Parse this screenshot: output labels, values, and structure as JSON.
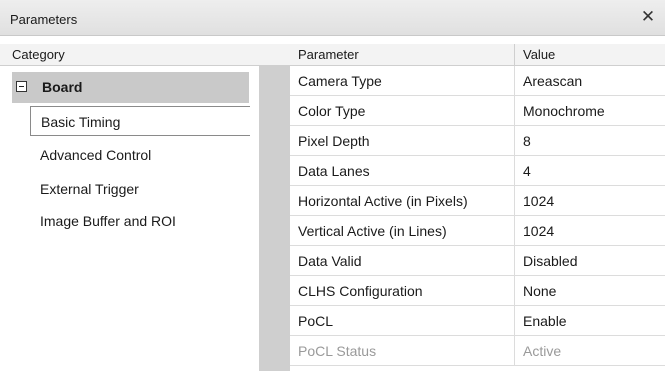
{
  "window": {
    "title": "Parameters",
    "close_label": "✕"
  },
  "headers": {
    "category": "Category",
    "parameter": "Parameter",
    "value": "Value"
  },
  "categories": {
    "group": {
      "label": "Board",
      "expanded": true
    },
    "items": [
      {
        "label": "Basic Timing",
        "selected": true
      },
      {
        "label": "Advanced Control",
        "selected": false
      },
      {
        "label": "External Trigger",
        "selected": false
      },
      {
        "label": "Image Buffer and ROI",
        "selected": false
      }
    ]
  },
  "parameters": [
    {
      "name": "Camera Type",
      "value": "Areascan",
      "enabled": true
    },
    {
      "name": "Color Type",
      "value": "Monochrome",
      "enabled": true
    },
    {
      "name": "Pixel Depth",
      "value": "8",
      "enabled": true
    },
    {
      "name": "Data Lanes",
      "value": "4",
      "enabled": true
    },
    {
      "name": "Horizontal Active (in Pixels)",
      "value": "1024",
      "enabled": true
    },
    {
      "name": "Vertical Active (in Lines)",
      "value": "1024",
      "enabled": true
    },
    {
      "name": "Data Valid",
      "value": "Disabled",
      "enabled": true
    },
    {
      "name": "CLHS Configuration",
      "value": "None",
      "enabled": true
    },
    {
      "name": "PoCL",
      "value": "Enable",
      "enabled": true
    },
    {
      "name": "PoCL Status",
      "value": "Active",
      "enabled": false
    }
  ],
  "colors": {
    "selection_bg": "#c9c9c9",
    "gutter": "#cfcfcf",
    "disabled_text": "#9a9a9a"
  }
}
